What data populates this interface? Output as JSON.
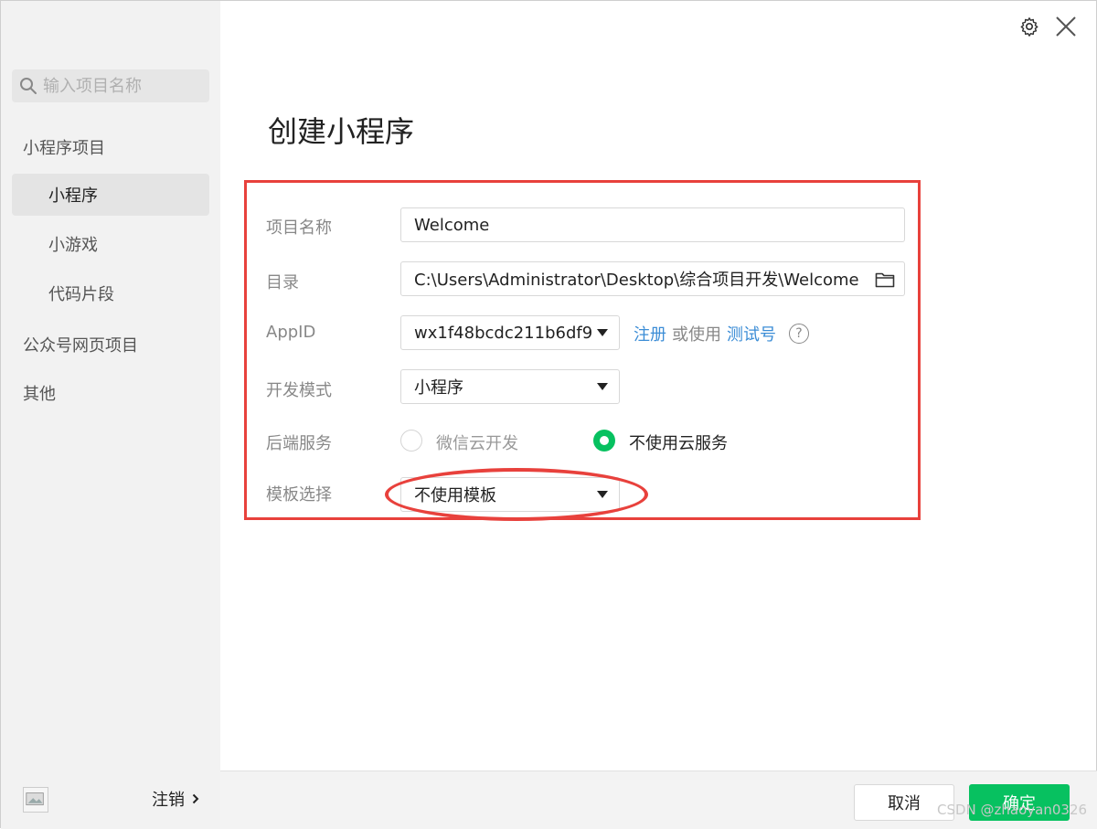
{
  "sidebar": {
    "search_placeholder": "输入项目名称",
    "group_miniprogram": "小程序项目",
    "items": [
      {
        "label": "小程序"
      },
      {
        "label": "小游戏"
      },
      {
        "label": "代码片段"
      }
    ],
    "group_official": "公众号网页项目",
    "group_other": "其他",
    "logout_label": "注销"
  },
  "main": {
    "title": "创建小程序",
    "project_name_label": "项目名称",
    "project_name_value": "Welcome",
    "directory_label": "目录",
    "directory_value": "C:\\Users\\Administrator\\Desktop\\综合项目开发\\Welcome",
    "appid_label": "AppID",
    "appid_value": "wx1f48bcdc211b6df9",
    "register_link": "注册",
    "or_use_text": "或使用",
    "test_account_link": "测试号",
    "help_symbol": "?",
    "dev_mode_label": "开发模式",
    "dev_mode_value": "小程序",
    "backend_label": "后端服务",
    "backend_option_cloud": "微信云开发",
    "backend_option_none": "不使用云服务",
    "backend_selected": "不使用云服务",
    "template_label": "模板选择",
    "template_value": "不使用模板"
  },
  "footer": {
    "cancel_label": "取消",
    "confirm_label": "确定"
  },
  "watermark": "CSDN @zhaoyan0326",
  "colors": {
    "accent_green": "#07c160",
    "link_blue": "#3c8dd6",
    "annotation_red": "#e8413c"
  }
}
